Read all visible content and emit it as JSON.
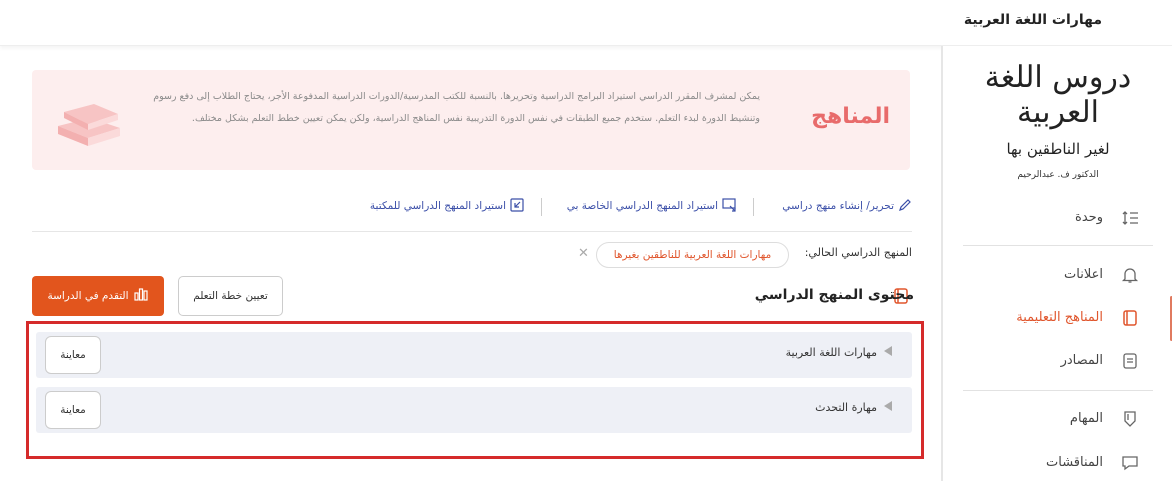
{
  "header": {
    "course_title": "مهارات اللغة العربية"
  },
  "sidebar": {
    "logo": {
      "line1": "دروس اللغة العربية",
      "line2": "لغير الناطقين بها",
      "author": "الدكتور ف. عبدالرحيم"
    },
    "items": [
      {
        "label": "وحدة",
        "icon": "list-order-icon",
        "active": false
      },
      {
        "label": "اعلانات",
        "icon": "bell-icon",
        "active": false
      },
      {
        "label": "المناهج التعليمية",
        "icon": "book-icon",
        "active": true
      },
      {
        "label": "المصادر",
        "icon": "resources-icon",
        "active": false
      },
      {
        "label": "المهام",
        "icon": "shield-icon",
        "active": false
      },
      {
        "label": "المناقشات",
        "icon": "chat-icon",
        "active": false
      }
    ],
    "accent_color": "#e0562d"
  },
  "banner": {
    "title": "المناهج",
    "text": "يمكن لمشرف المقرر الدراسي استيراد البرامج الدراسية وتحريرها. بالنسبة للكتب المدرسية/الدورات الدراسية المدفوعة الأجر، يحتاج الطلاب إلى دفع رسوم وتنشيط الدورة لبدء التعلم. ستخدم جميع الطبقات في نفس الدورة التدريبية نفس المناهج الدراسية، ولكن يمكن تعيين خطط التعلم بشكل مختلف."
  },
  "actions": {
    "edit": "تحرير/ إنشاء منهج دراسي",
    "import_mine": "استيراد المنهج الدراسي الخاصة بي",
    "import_library": "استيراد المنهج الدراسي للمكتبة"
  },
  "current": {
    "label": "المنهج الدراسي الحالي:",
    "value": "مهارات اللغة العربية للناطقين بغيرها"
  },
  "content": {
    "heading": "محتوى المنهج الدراسي",
    "plan_button": "تعيين خطة التعلم",
    "progress_button": "التقدم في الدراسة",
    "primary_color": "#e2551d",
    "rows": [
      {
        "title": "مهارات اللغة العربية",
        "preview": "معاينة"
      },
      {
        "title": "مهارة التحدث",
        "preview": "معاينة"
      }
    ]
  }
}
